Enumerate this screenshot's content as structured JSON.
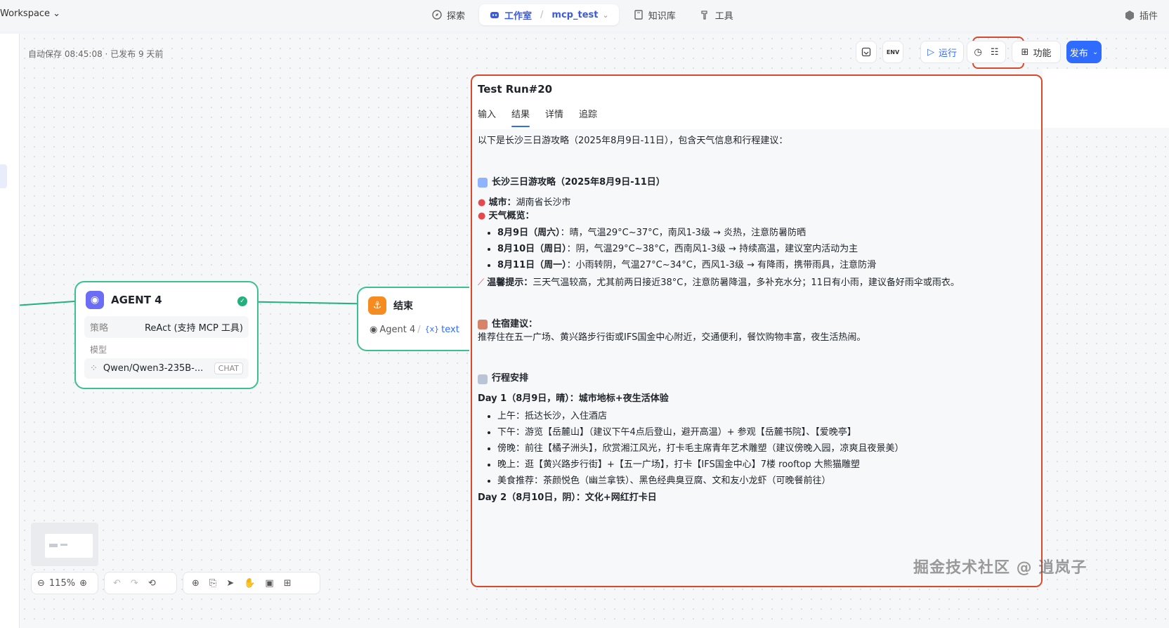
{
  "topbar": {
    "workspace": "Workspace",
    "nav": [
      {
        "label": "探索"
      },
      {
        "label": "工作室",
        "project": "mcp_test"
      },
      {
        "label": "知识库"
      },
      {
        "label": "工具"
      }
    ],
    "plugin": "插件"
  },
  "autosave": "自动保存 08:45:08 · 已发布 9 天前",
  "toolbar": {
    "run": "运行",
    "features": "功能",
    "publish": "发布",
    "env": "ENV"
  },
  "agent_node": {
    "title": "AGENT 4",
    "strategy_key": "策略",
    "strategy_value": "ReAct (支持 MCP 工具)",
    "model_label": "模型",
    "model_value": "Qwen/Qwen3-235B-...",
    "model_chip": "CHAT"
  },
  "end_node": {
    "title": "结束",
    "var_source": "Agent 4",
    "var_sep": "/",
    "var_badge": "{x}",
    "var_name": "text"
  },
  "zoom": "115%",
  "panel": {
    "title": "Test Run#20",
    "tabs": [
      "输入",
      "结果",
      "详情",
      "追踪"
    ],
    "intro": "以下是长沙三日游攻略（2025年8月9日-11日），包含天气信息和行程建议：",
    "guide_title": "长沙三日游攻略（2025年8月9日-11日）",
    "city_label": "城市：",
    "city_value": "湖南省长沙市",
    "weather_label": "天气概览：",
    "weather": [
      {
        "day": "8月9日（周六）",
        "desc": "：晴，气温29°C~37°C，南风1-3级 → 炎热，注意防暑防晒"
      },
      {
        "day": "8月10日（周日）",
        "desc": "：阴，气温29°C~38°C，西南风1-3级 → 持续高温，建议室内活动为主"
      },
      {
        "day": "8月11日（周一）",
        "desc": "：小雨转阴，气温27°C~34°C，西风1-3级 → 有降雨，携带雨具，注意防滑"
      }
    ],
    "tip_label": "温馨提示：",
    "tip_value": "三天气温较高，尤其前两日接近38°C，注意防暑降温，多补充水分；11日有小雨，建议备好雨伞或雨衣。",
    "hotel_label": "住宿建议：",
    "hotel_value": "推荐住在五一广场、黄兴路步行街或IFS国金中心附近，交通便利，餐饮购物丰富，夜生活热闹。",
    "itinerary_title": "行程安排",
    "day1_title": "Day 1（8月9日，晴）：城市地标+夜生活体验",
    "day1": [
      "上午：抵达长沙，入住酒店",
      "下午：游览【岳麓山】（建议下午4点后登山，避开高温）+ 参观【岳麓书院】、【爱晚亭】",
      "傍晚：前往【橘子洲头】，欣赏湘江风光，打卡毛主席青年艺术雕塑（建议傍晚入园，凉爽且夜景美）",
      "晚上：逛【黄兴路步行街】+【五一广场】，打卡【IFS国金中心】7楼 rooftop 大熊猫雕塑",
      "美食推荐：茶颜悦色（幽兰拿铁）、黑色经典臭豆腐、文和友小龙虾（可晚餐前往）"
    ],
    "day2_title": "Day 2（8月10日，阴）：文化+网红打卡日"
  },
  "watermark": "掘金技术社区 @ 逍岚子",
  "colors": {
    "accent": "#2f6bff",
    "highlight": "#d84a2b",
    "edge": "#22b07d"
  }
}
